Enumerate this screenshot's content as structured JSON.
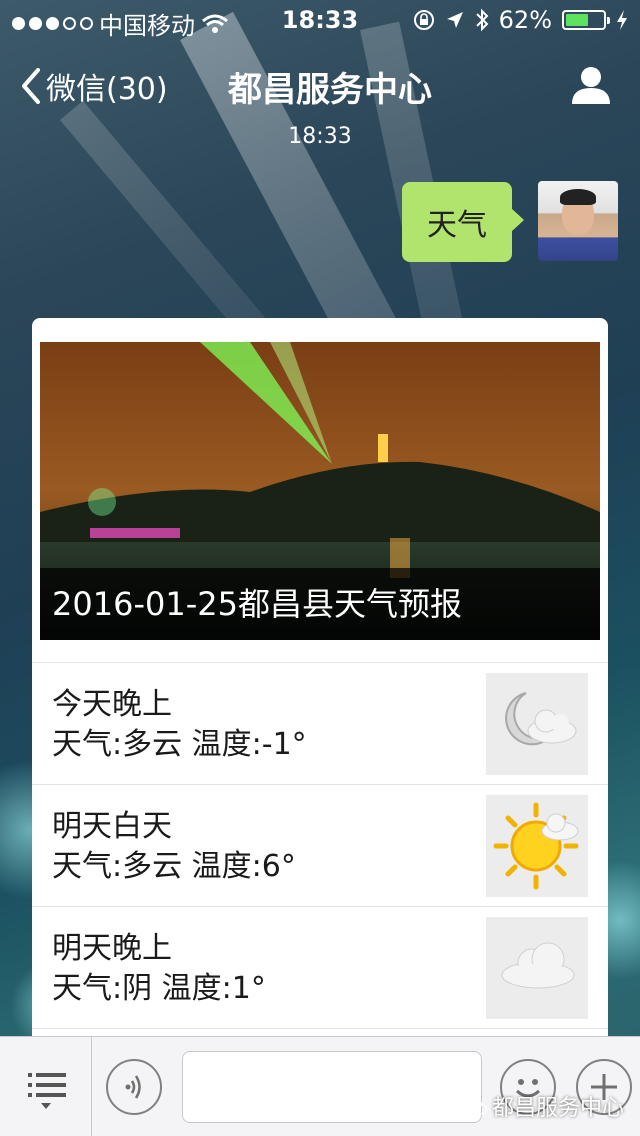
{
  "status_bar": {
    "carrier": "中国移动",
    "time": "18:33",
    "battery": "62%",
    "battery_level": 0.62
  },
  "nav": {
    "back_label": "微信(30)",
    "title": "都昌服务中心",
    "profile_icon": "person-icon"
  },
  "chat": {
    "timestamp": "18:33",
    "sent_message": "天气",
    "bubble_color": "#b0e46c"
  },
  "news_card": {
    "headline": "2016-01-25都昌县天气预报",
    "forecasts": [
      {
        "period": "今天晚上",
        "detail": "天气:多云 温度:-1°",
        "icon": "moon-cloud-icon"
      },
      {
        "period": "明天白天",
        "detail": "天气:多云 温度:6°",
        "icon": "sun-cloud-icon"
      },
      {
        "period": "明天晚上",
        "detail": "天气:阴 温度:1°",
        "icon": "cloud-icon"
      }
    ]
  },
  "input_bar": {
    "menu_icon": "menu-list-icon",
    "voice_icon": "voice-icon",
    "emoji_icon": "emoji-icon",
    "plus_icon": "plus-icon"
  },
  "watermark": "都昌服务中心"
}
